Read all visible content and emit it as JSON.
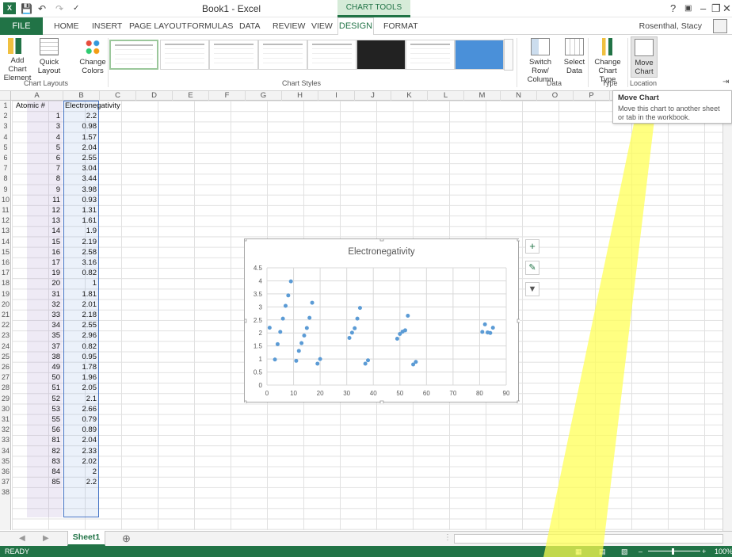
{
  "window": {
    "title": "Book1 - Excel",
    "context_band": "CHART TOOLS",
    "user": "Rosenthal, Stacy"
  },
  "tabs": [
    "FILE",
    "HOME",
    "INSERT",
    "PAGE LAYOUT",
    "FORMULAS",
    "DATA",
    "REVIEW",
    "VIEW",
    "DESIGN",
    "FORMAT"
  ],
  "ribbon": {
    "add_chart": "Add Chart Element",
    "quick_layout": "Quick Layout",
    "change_colors": "Change Colors",
    "chart_layouts": "Chart Layouts",
    "chart_styles": "Chart Styles",
    "switch_row_col": "Switch Row/ Column",
    "select_data": "Select Data",
    "data_group": "Data",
    "change_chart_type": "Change Chart Type",
    "type_group": "Type",
    "move_chart": "Move Chart",
    "location_group": "Location"
  },
  "tooltip": {
    "title": "Move Chart",
    "text": "Move this chart to another sheet or tab in the workbook."
  },
  "columns": [
    "A",
    "B",
    "C",
    "D",
    "E",
    "F",
    "G",
    "H",
    "I",
    "J",
    "K",
    "L",
    "M",
    "N",
    "O",
    "P"
  ],
  "header_row": {
    "a": "Atomic #",
    "b": "Electronegativity"
  },
  "rows": [
    [
      1,
      2.2
    ],
    [
      3,
      0.98
    ],
    [
      4,
      1.57
    ],
    [
      5,
      2.04
    ],
    [
      6,
      2.55
    ],
    [
      7,
      3.04
    ],
    [
      8,
      3.44
    ],
    [
      9,
      3.98
    ],
    [
      11,
      0.93
    ],
    [
      12,
      1.31
    ],
    [
      13,
      1.61
    ],
    [
      14,
      1.9
    ],
    [
      15,
      2.19
    ],
    [
      16,
      2.58
    ],
    [
      17,
      3.16
    ],
    [
      19,
      0.82
    ],
    [
      20,
      1
    ],
    [
      31,
      1.81
    ],
    [
      32,
      2.01
    ],
    [
      33,
      2.18
    ],
    [
      34,
      2.55
    ],
    [
      35,
      2.96
    ],
    [
      37,
      0.82
    ],
    [
      38,
      0.95
    ],
    [
      49,
      1.78
    ],
    [
      50,
      1.96
    ],
    [
      51,
      2.05
    ],
    [
      52,
      2.1
    ],
    [
      53,
      2.66
    ],
    [
      55,
      0.79
    ],
    [
      56,
      0.89
    ],
    [
      81,
      2.04
    ],
    [
      82,
      2.33
    ],
    [
      83,
      2.02
    ],
    [
      84,
      2
    ],
    [
      85,
      2.2
    ]
  ],
  "sheet_tab": "Sheet1",
  "status": {
    "left": "READY",
    "zoom": "100%"
  },
  "chart_data": {
    "type": "scatter",
    "title": "Electronegativity",
    "x_ticks": [
      "0",
      "10",
      "20",
      "30",
      "40",
      "50",
      "60",
      "70",
      "80",
      "90"
    ],
    "y_ticks": [
      "0",
      "0.5",
      "1",
      "1.5",
      "2",
      "2.5",
      "3",
      "3.5",
      "4",
      "4.5"
    ],
    "xlim": [
      0,
      90
    ],
    "ylim": [
      0,
      4.5
    ],
    "grid": true,
    "series_color": "#5b9bd5",
    "x": [
      1,
      3,
      4,
      5,
      6,
      7,
      8,
      9,
      11,
      12,
      13,
      14,
      15,
      16,
      17,
      19,
      20,
      31,
      32,
      33,
      34,
      35,
      37,
      38,
      49,
      50,
      51,
      52,
      53,
      55,
      56,
      81,
      82,
      83,
      84,
      85
    ],
    "y": [
      2.2,
      0.98,
      1.57,
      2.04,
      2.55,
      3.04,
      3.44,
      3.98,
      0.93,
      1.31,
      1.61,
      1.9,
      2.19,
      2.58,
      3.16,
      0.82,
      1,
      1.81,
      2.01,
      2.18,
      2.55,
      2.96,
      0.82,
      0.95,
      1.78,
      1.96,
      2.05,
      2.1,
      2.66,
      0.79,
      0.89,
      2.04,
      2.33,
      2.02,
      2,
      2.2
    ]
  },
  "colors": {
    "excel_green": "#217346",
    "highlight": "#ffff50"
  }
}
